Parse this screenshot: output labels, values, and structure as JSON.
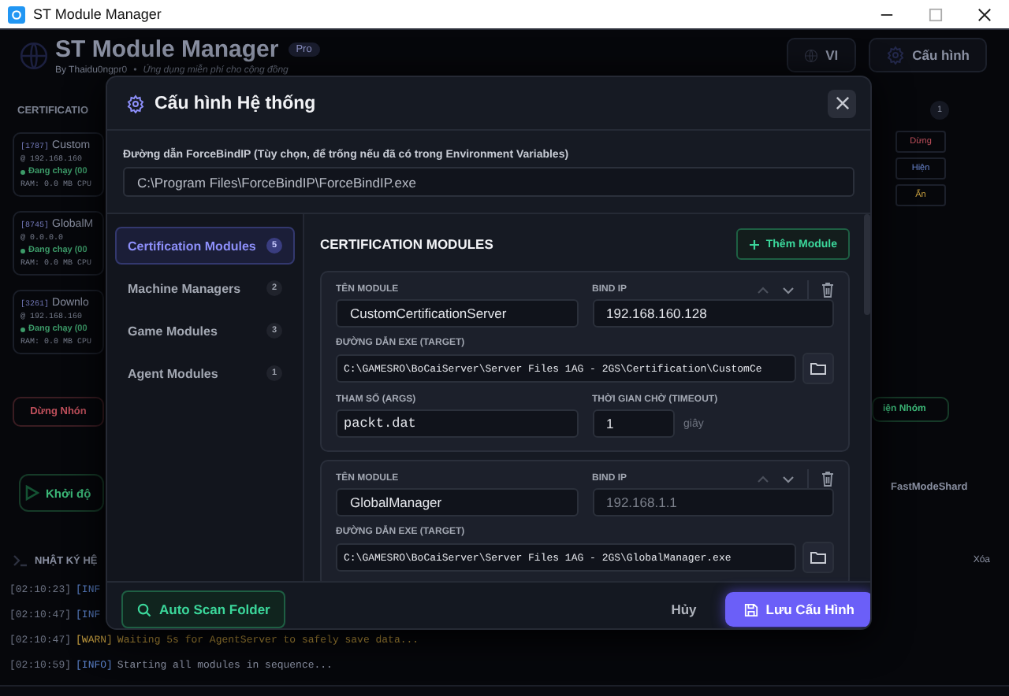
{
  "window": {
    "title": "ST Module Manager"
  },
  "app_header": {
    "title": "ST Module Manager",
    "badge": "Pro",
    "author": "By Thaidu0ngpr0",
    "separator": "•",
    "tagline": "Ứng dụng miễn phí cho cộng đồng",
    "language_button": "VI",
    "settings_button": "Cấu hình"
  },
  "background": {
    "section_title": "CERTIFICATIO",
    "section_count": "1",
    "cards": [
      {
        "id": "[1787]",
        "name": "Custom",
        "address": "@ 192.168.160",
        "status": "Đang chạy (00",
        "stats": "RAM: 0.0 MB  CPU"
      },
      {
        "id": "[8745]",
        "name": "GlobalM",
        "address": "@ 0.0.0.0",
        "status": "Đang chạy (00",
        "stats": "RAM: 0.0 MB  CPU"
      },
      {
        "id": "[3261]",
        "name": "Downlo",
        "address": "@ 192.168.160",
        "status": "Đang chạy (00",
        "stats": "RAM: 0.0 MB  CPU"
      }
    ],
    "card_actions": [
      {
        "label": "Dừng",
        "kind": "stop"
      },
      {
        "label": "Hiện",
        "kind": "show"
      },
      {
        "label": "Ẩn",
        "kind": "hide"
      }
    ],
    "stop_group": "Dừng Nhón",
    "show_group": "iện Nhóm",
    "start_all": "Khởi độ",
    "fast_mode": "FastModeShard",
    "log_title": "NHẬT KÝ HỆ",
    "clear_log": "Xóa",
    "logs": [
      {
        "time": "[02:10:23]",
        "level": "[INF",
        "kind": "info"
      },
      {
        "time": "[02:10:47]",
        "level": "[INF",
        "kind": "info"
      },
      {
        "time": "[02:10:47]",
        "level": "[WARN]",
        "kind": "warn",
        "message": "Waiting 5s for AgentServer to safely save data..."
      },
      {
        "time": "[02:10:59]",
        "level": "[INFO]",
        "kind": "info",
        "message": "Starting all modules in sequence..."
      }
    ]
  },
  "dialog": {
    "title": "Cấu hình Hệ thống",
    "forcebindip": {
      "label": "Đường dẫn ForceBindIP (Tùy chọn, để trống nếu đã có trong Environment Variables)",
      "value": "C:\\Program Files\\ForceBindIP\\ForceBindIP.exe"
    },
    "categories": [
      {
        "label": "Certification Modules",
        "count": "5",
        "selected": true
      },
      {
        "label": "Machine Managers",
        "count": "2",
        "selected": false
      },
      {
        "label": "Game Modules",
        "count": "3",
        "selected": false
      },
      {
        "label": "Agent Modules",
        "count": "1",
        "selected": false
      }
    ],
    "panel_title": "CERTIFICATION MODULES",
    "add_button": "Thêm Module",
    "modules": [
      {
        "name_label": "TÊN MODULE",
        "name": "CustomCertificationServer",
        "ip_label": "BIND IP",
        "ip": {
          "value": "192.168.160.128"
        },
        "exe_label": "ĐƯỜNG DẪN EXE (TARGET)",
        "exe": "C:\\GAMESRO\\BoCaiServer\\Server Files 1AG - 2GS\\Certification\\CustomCe",
        "args_label": "THAM SỐ (ARGS)",
        "args": "packt.dat",
        "timeout_label": "THỜI GIAN CHỜ (TIMEOUT)",
        "timeout": "1",
        "timeout_unit": "giây"
      },
      {
        "name_label": "TÊN MODULE",
        "name": "GlobalManager",
        "ip_label": "BIND IP",
        "ip": {
          "placeholder": "192.168.1.1"
        },
        "exe_label": "ĐƯỜNG DẪN EXE (TARGET)",
        "exe": "C:\\GAMESRO\\BoCaiServer\\Server Files 1AG - 2GS\\GlobalManager.exe"
      }
    ],
    "footer": {
      "scan_button": "Auto Scan Folder",
      "cancel_button": "Hủy",
      "save_button": "Lưu Cấu Hình"
    }
  }
}
